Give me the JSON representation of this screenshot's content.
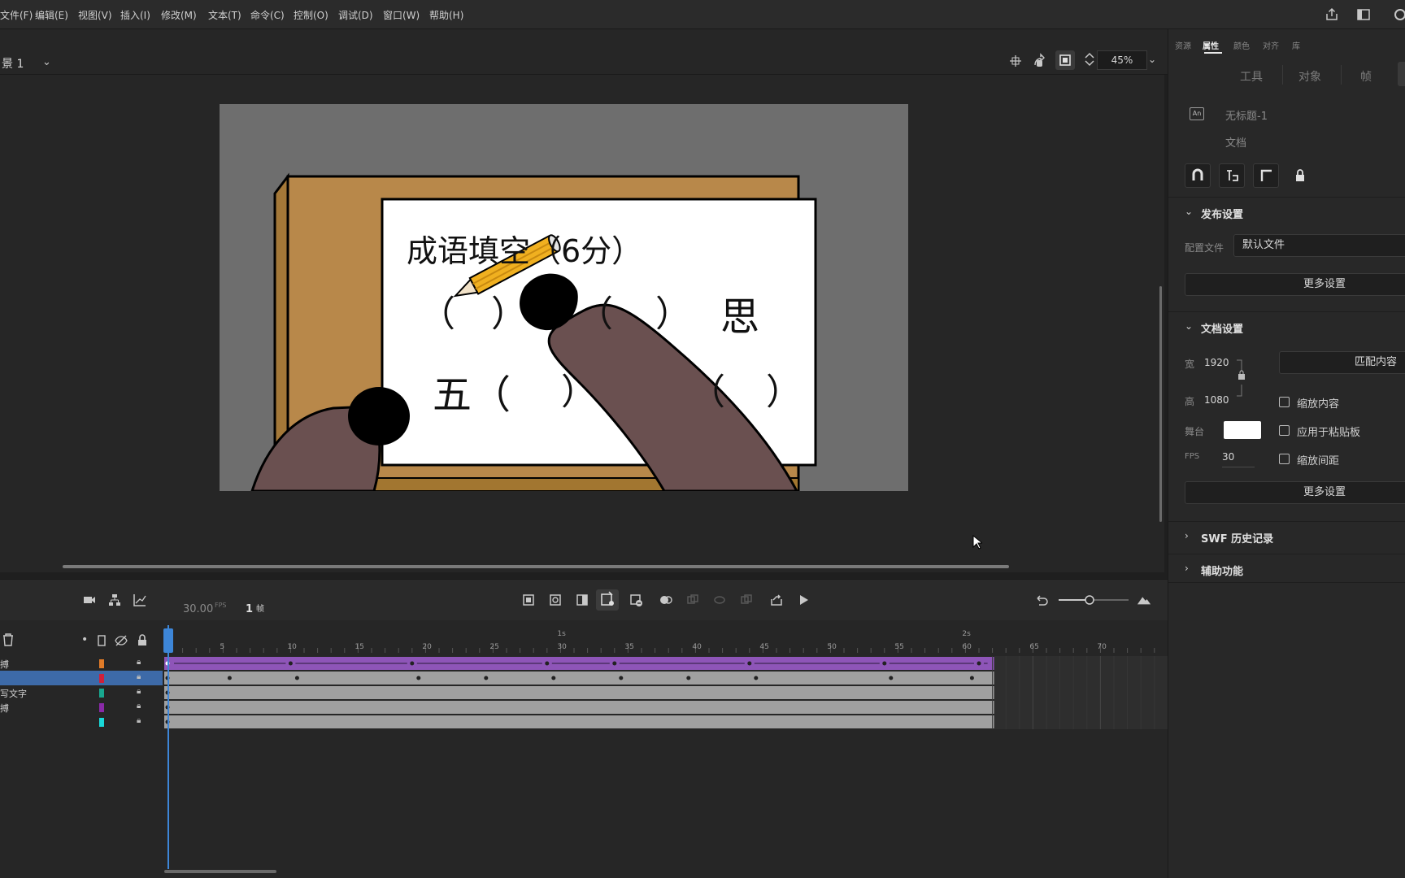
{
  "menu": [
    "文件(F)",
    "编辑(E)",
    "视图(V)",
    "插入(I)",
    "修改(M)",
    "文本(T)",
    "命令(C)",
    "控制(O)",
    "调试(D)",
    "窗口(W)",
    "帮助(H)"
  ],
  "editbar": {
    "scene": "景 1",
    "zoom": "45%"
  },
  "stage_art": {
    "heading": "成语填空（6分）",
    "line1": [
      "（",
      "）",
      "（",
      "）",
      "思"
    ],
    "line2": [
      "五（",
      "）",
      "（",
      "）"
    ]
  },
  "timeline": {
    "fps": "30.00",
    "fps_unit": "FPS",
    "frame": "1",
    "frame_unit": "帧",
    "ruler_numbers": [
      "5",
      "10",
      "15",
      "20",
      "25",
      "30",
      "35",
      "40",
      "45",
      "50",
      "55",
      "60",
      "65",
      "70"
    ],
    "ruler_seconds": [
      "1s",
      "2s"
    ],
    "layers": [
      {
        "name": "搏",
        "color": "#e07b28",
        "selected": false
      },
      {
        "name": "",
        "color": "#d0203a",
        "selected": true
      },
      {
        "name": "写文字",
        "color": "#18a890",
        "selected": false
      },
      {
        "name": "搏",
        "color": "#8a2aa8",
        "selected": false
      },
      {
        "name": "",
        "color": "#19d8d8",
        "selected": false
      }
    ]
  },
  "panel": {
    "tabs": [
      "资源",
      "属性",
      "颜色",
      "对齐",
      "库"
    ],
    "active_tab": "属性",
    "subtabs": [
      "工具",
      "对象",
      "帧"
    ],
    "doc_icon": "An",
    "doc_name": "无标题-1",
    "doc_kind": "文档",
    "publish": {
      "title": "发布设置",
      "profile_label": "配置文件",
      "profile_value": "默认文件",
      "more": "更多设置"
    },
    "document": {
      "title": "文档设置",
      "width_label": "宽",
      "width": "1920",
      "height_label": "高",
      "height": "1080",
      "match": "匹配内容",
      "stage_label": "舞台",
      "stage_color": "#ffffff",
      "fps_label": "FPS",
      "fps": "30",
      "scale_content": "缩放内容",
      "apply_pasteboard": "应用于粘贴板",
      "scale_spacing": "缩放间距",
      "more": "更多设置"
    },
    "swf": "SWF 历史记录",
    "accessibility": "辅助功能"
  }
}
